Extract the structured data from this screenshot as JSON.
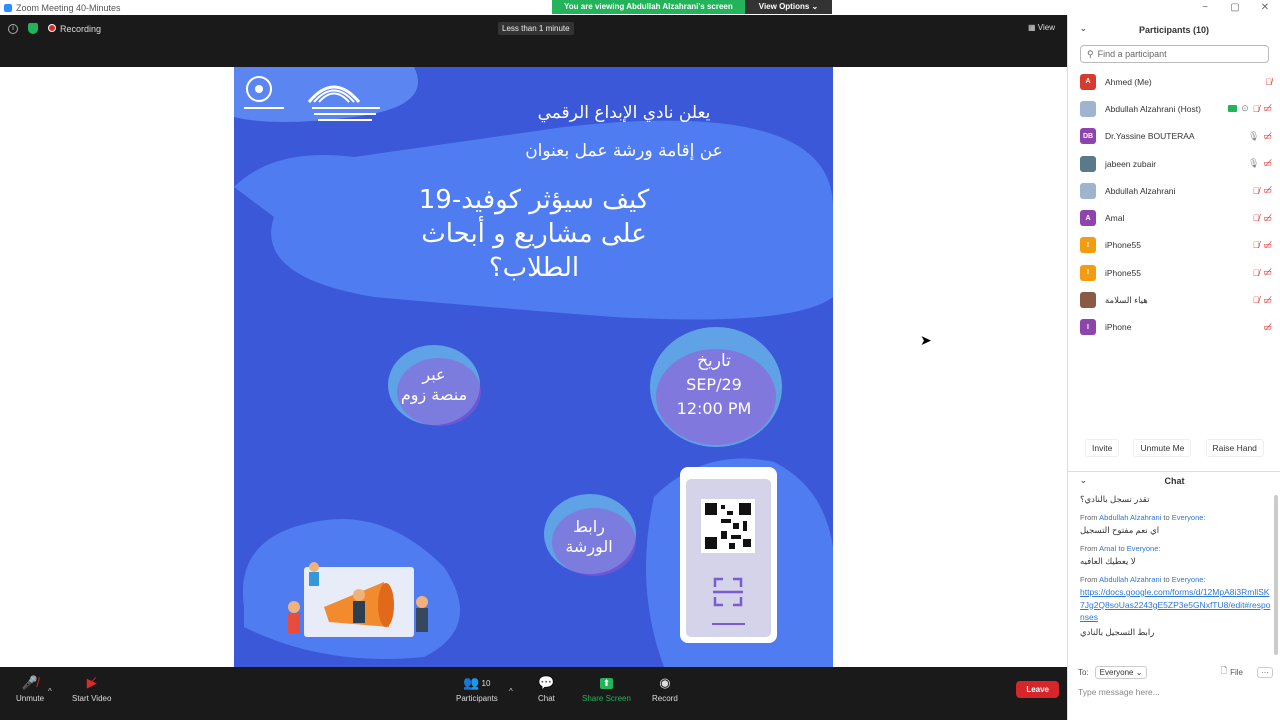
{
  "window": {
    "title": "Zoom Meeting 40-Minutes"
  },
  "banner": {
    "viewing": "You are viewing Abdullah Alzahrani's screen",
    "view_options": "View Options ⌄"
  },
  "meeting": {
    "recording": "Recording",
    "timer": "Less than 1 minute",
    "view": "View"
  },
  "poster": {
    "line1": "يعلن نادي الإبداع الرقمي",
    "line2": "عن إقامة ورشة عمل بعنوان",
    "title1": "كيف سيؤثر كوفيد-19",
    "title2": "على مشاريع و أبحاث",
    "title3": "الطلاب؟",
    "date_label": "تاريخ",
    "date": "SEP/29",
    "time": "12:00 PM",
    "via1": "عبر",
    "via2": "منصة زوم",
    "link1": "رابط",
    "link2": "الورشة"
  },
  "toolbar": {
    "unmute": "Unmute",
    "start_video": "Start Video",
    "participants": "Participants",
    "participants_count": "10",
    "chat": "Chat",
    "share_screen": "Share Screen",
    "record": "Record",
    "leave": "Leave"
  },
  "participants": {
    "header": "Participants (10)",
    "search_placeholder": "Find a participant",
    "list": [
      {
        "initials": "A",
        "name": "Ahmed (Me)",
        "color": "#d63b2f"
      },
      {
        "initials": "",
        "name": "Abdullah Alzahrani (Host)",
        "color": "#9fb4cf"
      },
      {
        "initials": "DB",
        "name": "Dr.Yassine BOUTERAA",
        "color": "#8e44ad"
      },
      {
        "initials": "",
        "name": "jabeen zubair",
        "color": "#5a7a8c"
      },
      {
        "initials": "",
        "name": "Abdullah Alzahrani",
        "color": "#9fb4cf"
      },
      {
        "initials": "A",
        "name": "Amal",
        "color": "#8e44ad"
      },
      {
        "initials": "I",
        "name": "iPhone55",
        "color": "#f39c12"
      },
      {
        "initials": "I",
        "name": "iPhone55",
        "color": "#f39c12"
      },
      {
        "initials": "",
        "name": "هياء السلامة",
        "color": "#8a5a44"
      },
      {
        "initials": "I",
        "name": "iPhone",
        "color": "#8e44ad"
      }
    ],
    "invite": "Invite",
    "unmute_me": "Unmute Me",
    "raise_hand": "Raise Hand"
  },
  "chat": {
    "header": "Chat",
    "messages": [
      {
        "text": "تقدر نسجل بالنادي؟"
      },
      {
        "from_label": "From",
        "sender": "Abdullah Alzahrani",
        "to_label": "to",
        "recipient": "Everyone:",
        "text": "اي نعم مفتوح التسجيل"
      },
      {
        "from_label": "From",
        "sender": "Amal",
        "to_label": "to",
        "recipient": "Everyone:",
        "text": "لا يعطيك العافيه"
      },
      {
        "from_label": "From",
        "sender": "Abdullah Alzahrani",
        "to_label": "to",
        "recipient": "Everyone:",
        "link": "https://docs.google.com/forms/d/12MpA8i3RmllSK7Jg2Q8soUas2243gE5ZP3e5GNxfTU8/edit#responses",
        "text": "رابط التسجيل بالنادي"
      }
    ],
    "to_label": "To:",
    "to_value": "Everyone ⌄",
    "file": "File",
    "more": "···",
    "input_placeholder": "Type message here..."
  }
}
